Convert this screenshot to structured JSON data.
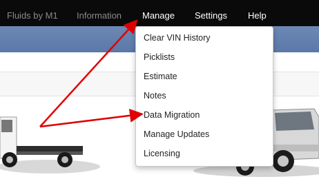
{
  "nav": {
    "items": [
      {
        "label": "Fluids by M1",
        "dim": true
      },
      {
        "label": "Information",
        "dim": true
      },
      {
        "label": "Manage",
        "dim": false
      },
      {
        "label": "Settings",
        "dim": false
      },
      {
        "label": "Help",
        "dim": false
      }
    ]
  },
  "manage_menu": {
    "items": [
      {
        "label": "Clear VIN History"
      },
      {
        "label": "Picklists"
      },
      {
        "label": "Estimate"
      },
      {
        "label": "Notes"
      },
      {
        "label": "Data Migration"
      },
      {
        "label": "Manage Updates"
      },
      {
        "label": "Licensing"
      }
    ]
  },
  "colors": {
    "topbar": "#0a0a0a",
    "blueband": "#5f7dad",
    "annotation_arrow": "#e00000"
  },
  "icons": {
    "left_vehicle": "truck-chassis-icon",
    "right_vehicle": "suv-icon"
  }
}
